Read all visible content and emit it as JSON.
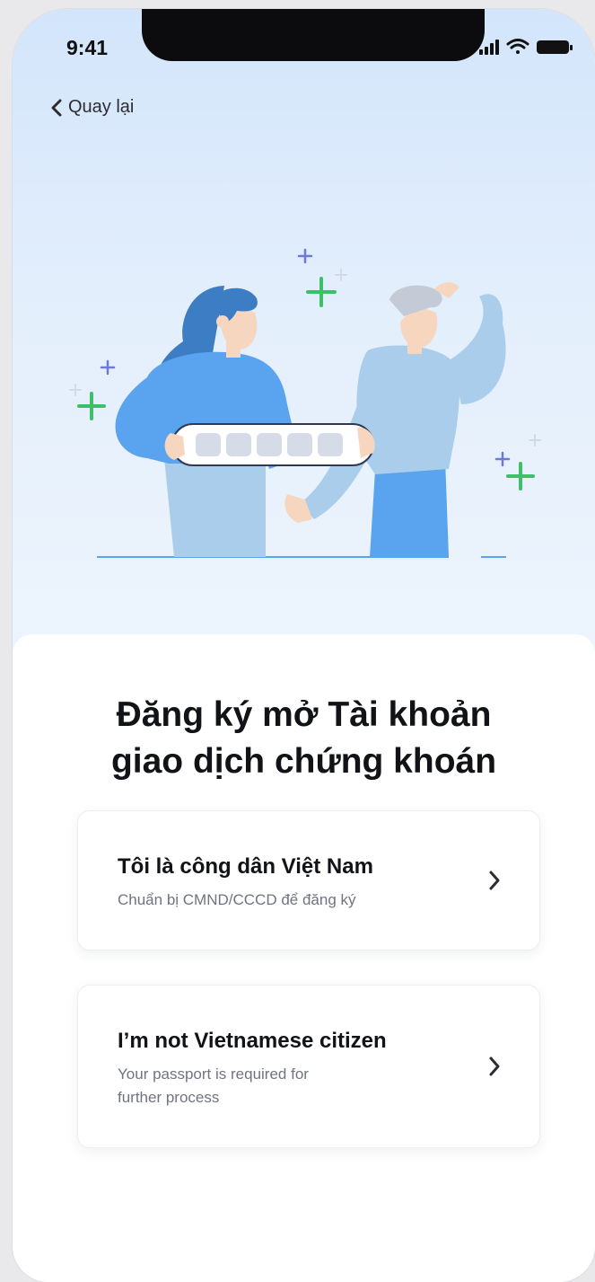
{
  "status_bar": {
    "time": "9:41",
    "icons": [
      "signal-icon",
      "wifi-icon",
      "battery-icon"
    ]
  },
  "nav": {
    "back_label": "Quay lại",
    "back_icon": "chevron-left-icon"
  },
  "illustration": {
    "subject": "two-people-holding-password-field",
    "colors": {
      "blue_primary": "#5aa3ee",
      "blue_light": "#a9cdea",
      "sparkle_green": "#3fbf6a",
      "sparkle_blue": "#6f79d8"
    }
  },
  "title_line1": "Đăng ký mở Tài khoản",
  "title_line2": "giao dịch chứng khoán",
  "options": [
    {
      "title": "Tôi là công dân Việt Nam",
      "subtitle": "Chuẩn bị CMND/CCCD để đăng ký",
      "icon": "chevron-right-icon"
    },
    {
      "title": "I’m not Vietnamese citizen",
      "subtitle_line1": "Your passport is required for",
      "subtitle_line2": "further process",
      "icon": "chevron-right-icon"
    }
  ]
}
